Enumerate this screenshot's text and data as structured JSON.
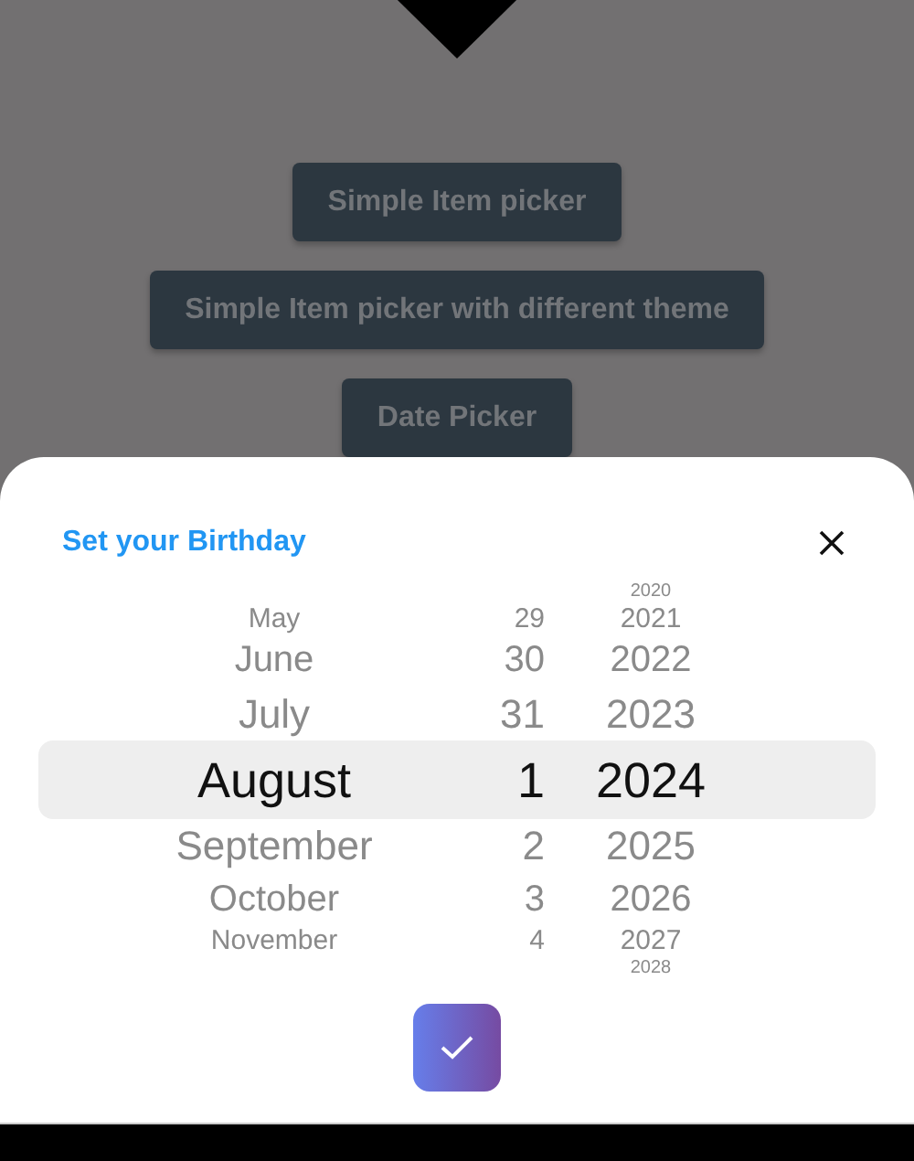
{
  "background_buttons": [
    "Simple Item picker",
    "Simple Item picker with different theme",
    "Date Picker"
  ],
  "sheet": {
    "title": "Set your Birthday",
    "months": [
      {
        "label": "May",
        "selected": false
      },
      {
        "label": "June",
        "selected": false
      },
      {
        "label": "July",
        "selected": false
      },
      {
        "label": "August",
        "selected": true
      },
      {
        "label": "September",
        "selected": false
      },
      {
        "label": "October",
        "selected": false
      },
      {
        "label": "November",
        "selected": false
      }
    ],
    "days": [
      {
        "label": "29",
        "selected": false
      },
      {
        "label": "30",
        "selected": false
      },
      {
        "label": "31",
        "selected": false
      },
      {
        "label": "1",
        "selected": true
      },
      {
        "label": "2",
        "selected": false
      },
      {
        "label": "3",
        "selected": false
      },
      {
        "label": "4",
        "selected": false
      }
    ],
    "years": [
      {
        "label": "2020",
        "selected": false
      },
      {
        "label": "2021",
        "selected": false
      },
      {
        "label": "2022",
        "selected": false
      },
      {
        "label": "2023",
        "selected": false
      },
      {
        "label": "2024",
        "selected": true
      },
      {
        "label": "2025",
        "selected": false
      },
      {
        "label": "2026",
        "selected": false
      },
      {
        "label": "2027",
        "selected": false
      },
      {
        "label": "2028",
        "selected": false
      }
    ]
  }
}
